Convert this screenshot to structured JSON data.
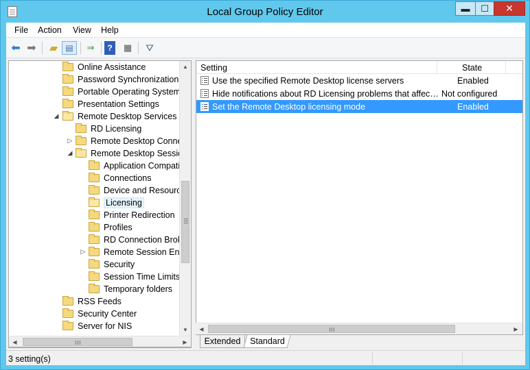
{
  "window": {
    "title": "Local Group Policy Editor",
    "min_glyph": "▬",
    "max_glyph": "☐",
    "close_glyph": "✕"
  },
  "menu": [
    "File",
    "Action",
    "View",
    "Help"
  ],
  "toolbar": {
    "icons": [
      "back-arrow-icon",
      "forward-arrow-icon",
      "up-folder-icon",
      "show-hide-tree-icon",
      "export-list-icon",
      "help-icon",
      "properties-icon",
      "filter-icon"
    ]
  },
  "tree": {
    "items": [
      {
        "label": "Online Assistance",
        "expander": ""
      },
      {
        "label": "Password Synchronization",
        "expander": ""
      },
      {
        "label": "Portable Operating System",
        "expander": ""
      },
      {
        "label": "Presentation Settings",
        "expander": ""
      },
      {
        "label": "Remote Desktop Services",
        "expander": "◢"
      },
      {
        "label": "RD Licensing",
        "expander": ""
      },
      {
        "label": "Remote Desktop Connec",
        "expander": "▷"
      },
      {
        "label": "Remote Desktop Session",
        "expander": "◢"
      },
      {
        "label": "Application Compati",
        "expander": ""
      },
      {
        "label": "Connections",
        "expander": ""
      },
      {
        "label": "Device and Resource",
        "expander": ""
      },
      {
        "label": "Licensing",
        "expander": ""
      },
      {
        "label": "Printer Redirection",
        "expander": ""
      },
      {
        "label": "Profiles",
        "expander": ""
      },
      {
        "label": "RD Connection Broke",
        "expander": ""
      },
      {
        "label": "Remote Session Envir",
        "expander": "▷"
      },
      {
        "label": "Security",
        "expander": ""
      },
      {
        "label": "Session Time Limits",
        "expander": ""
      },
      {
        "label": "Temporary folders",
        "expander": ""
      },
      {
        "label": "RSS Feeds",
        "expander": ""
      },
      {
        "label": "Security Center",
        "expander": ""
      },
      {
        "label": "Server for NIS",
        "expander": ""
      }
    ],
    "selected": "Licensing"
  },
  "list": {
    "columns": [
      "Setting",
      "State"
    ],
    "rows": [
      {
        "setting": "Use the specified Remote Desktop license servers",
        "state": "Enabled"
      },
      {
        "setting": "Hide notifications about RD Licensing problems that affect t...",
        "state": "Not configured"
      },
      {
        "setting": "Set the Remote Desktop licensing mode",
        "state": "Enabled"
      }
    ]
  },
  "tabs": [
    "Extended",
    "Standard"
  ],
  "status": {
    "text": "3 setting(s)"
  },
  "scroll": {
    "up": "▲",
    "down": "▼",
    "left": "◀",
    "right": "▶"
  },
  "colors": {
    "title_bar": "#60c8ec",
    "selection": "#3399ff",
    "close_button": "#c7372f"
  }
}
